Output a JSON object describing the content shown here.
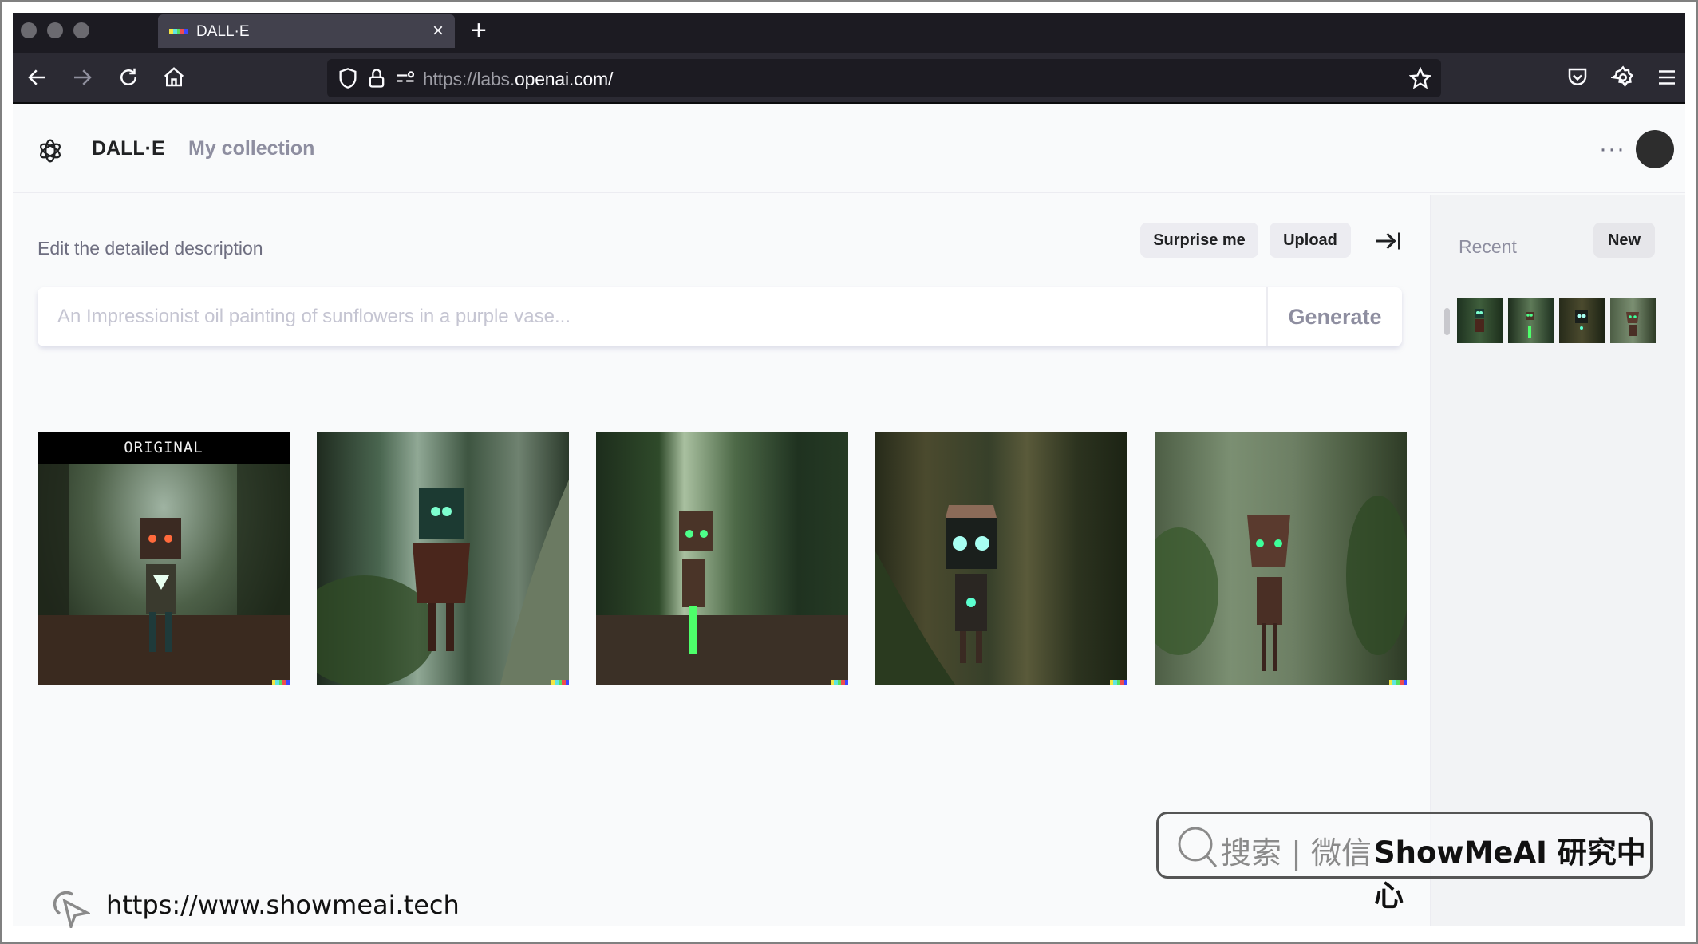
{
  "browser": {
    "tab_title": "DALL·E",
    "tab_close_icon": "close-icon",
    "new_tab_icon": "plus-icon",
    "url_prefix": "https://labs.",
    "url_domain": "openai.com/",
    "nav_icons": [
      "back-icon",
      "forward-icon",
      "reload-icon",
      "home-icon"
    ],
    "urlbar_icons": [
      "shield-icon",
      "lock-icon",
      "permissions-icon",
      "star-icon"
    ],
    "toolbar_icons": [
      "pocket-icon",
      "settings-icon",
      "menu-icon"
    ]
  },
  "header": {
    "brand": "DALL·E",
    "nav_link": "My collection",
    "more_label": "···"
  },
  "editor": {
    "label": "Edit the detailed description",
    "surprise_label": "Surprise me",
    "upload_label": "Upload",
    "prompt_placeholder": "An Impressionist oil painting of sunflowers in a purple vase...",
    "prompt_value": "",
    "generate_label": "Generate"
  },
  "results": {
    "original_label": "ORIGINAL",
    "images": [
      {
        "name": "original",
        "description": "Robot with red eyes and glowing triangle chest in forest"
      },
      {
        "name": "variation-1",
        "description": "Robot with green glowing eyes beside tree trunk"
      },
      {
        "name": "variation-2",
        "description": "Robot with green eyes and glowing green leg among ferns"
      },
      {
        "name": "variation-3",
        "description": "Box-head robot with cyan eyes and glowing chest"
      },
      {
        "name": "variation-4",
        "description": "Robot with green eyes and flared head in misty forest"
      }
    ]
  },
  "sidebar": {
    "recent_label": "Recent",
    "new_label": "New",
    "thumbnails": 4
  },
  "overlay": {
    "search_text": "搜索 | 微信",
    "brand_text": "ShowMeAI 研究中心",
    "site_url": "https://www.showmeai.tech"
  },
  "colors": {
    "dalle_strip": [
      "#f5e642",
      "#5fe4e0",
      "#56e05f",
      "#ee4d4d",
      "#3c46ff"
    ]
  }
}
